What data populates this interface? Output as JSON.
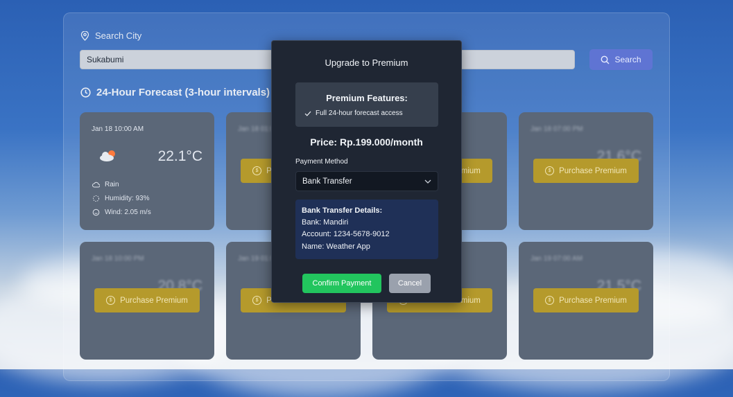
{
  "search": {
    "label": "Search City",
    "value": "Sukabumi",
    "button_label": "Search"
  },
  "forecast": {
    "title": "24-Hour Forecast (3-hour intervals)",
    "purchase_label": "Purchase Premium",
    "cards": [
      {
        "date": "Jan 18 10:00 AM",
        "temp": "22.1°C",
        "condition": "Rain",
        "humidity": "Humidity: 93%",
        "wind": "Wind: 2.05 m/s",
        "locked": false
      },
      {
        "date": "Jan 18 01:00 PM",
        "temp": "",
        "condition": "",
        "humidity": "",
        "wind": "",
        "locked": true
      },
      {
        "date": "",
        "temp": "",
        "condition": "",
        "humidity": "",
        "wind": "",
        "locked": true
      },
      {
        "date": "Jan 18 07:00 PM",
        "temp": "21.6°C",
        "condition": "",
        "humidity": "",
        "wind": "",
        "locked": true
      },
      {
        "date": "Jan 18 10:00 PM",
        "temp": "20.8°C",
        "condition": "",
        "humidity": "",
        "wind": "",
        "locked": true
      },
      {
        "date": "Jan 19 01:00 AM",
        "temp": "",
        "condition": "",
        "humidity": "",
        "wind": "",
        "locked": true
      },
      {
        "date": "",
        "temp": "",
        "condition": "",
        "humidity": "",
        "wind": "",
        "locked": true
      },
      {
        "date": "Jan 19 07:00 AM",
        "temp": "21.5°C",
        "condition": "",
        "humidity": "",
        "wind": "",
        "locked": true
      }
    ]
  },
  "modal": {
    "title": "Upgrade to Premium",
    "features_title": "Premium Features:",
    "features": [
      "Full 24-hour forecast access"
    ],
    "price": "Price: Rp.199.000/month",
    "payment_method_label": "Payment Method",
    "payment_method_value": "Bank Transfer",
    "bank_details": {
      "title": "Bank Transfer Details:",
      "bank": "Bank: Mandiri",
      "account": "Account: 1234-5678-9012",
      "name": "Name: Weather App"
    },
    "confirm_label": "Confirm Payment",
    "cancel_label": "Cancel"
  },
  "colors": {
    "accent": "#5f74d3",
    "premium": "#b59a2c",
    "confirm": "#22c55e",
    "cancel": "#9aa1ad"
  }
}
